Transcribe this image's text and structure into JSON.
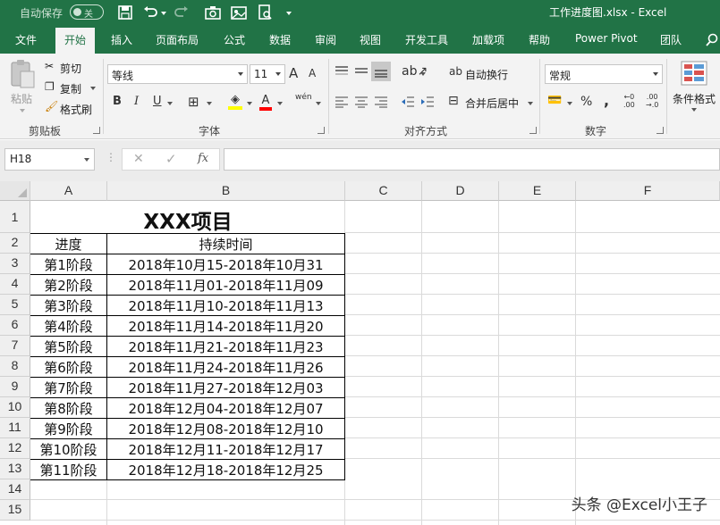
{
  "titlebar": {
    "autosave_label": "自动保存",
    "autosave_state": "关",
    "document_title": "工作进度图.xlsx  -  Excel"
  },
  "tabs": [
    "文件",
    "开始",
    "插入",
    "页面布局",
    "公式",
    "数据",
    "审阅",
    "视图",
    "开发工具",
    "加载项",
    "帮助",
    "Power Pivot",
    "团队"
  ],
  "active_tab": "开始",
  "ribbon": {
    "clipboard": {
      "paste": "粘贴",
      "cut": "剪切",
      "copy": "复制",
      "format_painter": "格式刷",
      "group": "剪贴板"
    },
    "font": {
      "name": "等线",
      "size": "11",
      "bold": "B",
      "italic": "I",
      "underline": "U",
      "grow": "A",
      "shrink": "A",
      "group": "字体",
      "phonetic": "wén"
    },
    "alignment": {
      "wrap": "自动换行",
      "merge": "合并后居中",
      "group": "对齐方式"
    },
    "number": {
      "format": "常规",
      "percent": "%",
      "comma": ",",
      "group": "数字"
    },
    "styles": {
      "conditional": "条件格式"
    }
  },
  "formula_bar": {
    "name_box": "H18",
    "fx": "fx",
    "formula": ""
  },
  "columns": [
    "A",
    "B",
    "C",
    "D",
    "E",
    "F"
  ],
  "rows": [
    "1",
    "2",
    "3",
    "4",
    "5",
    "6",
    "7",
    "8",
    "9",
    "10",
    "11",
    "12",
    "13",
    "14",
    "15"
  ],
  "sheet": {
    "title": "XXX项目",
    "headers": [
      "进度",
      "持续时间"
    ],
    "data": [
      [
        "第1阶段",
        "2018年10月15-2018年10月31"
      ],
      [
        "第2阶段",
        "2018年11月01-2018年11月09"
      ],
      [
        "第3阶段",
        "2018年11月10-2018年11月13"
      ],
      [
        "第4阶段",
        "2018年11月14-2018年11月20"
      ],
      [
        "第5阶段",
        "2018年11月21-2018年11月23"
      ],
      [
        "第6阶段",
        "2018年11月24-2018年11月26"
      ],
      [
        "第7阶段",
        "2018年11月27-2018年12月03"
      ],
      [
        "第8阶段",
        "2018年12月04-2018年12月07"
      ],
      [
        "第9阶段",
        "2018年12月08-2018年12月10"
      ],
      [
        "第10阶段",
        "2018年12月11-2018年12月17"
      ],
      [
        "第11阶段",
        "2018年12月18-2018年12月25"
      ]
    ]
  },
  "watermark": "头条 @Excel小王子",
  "colors": {
    "accent": "#217346",
    "ribbon": "#f3f3f3"
  }
}
